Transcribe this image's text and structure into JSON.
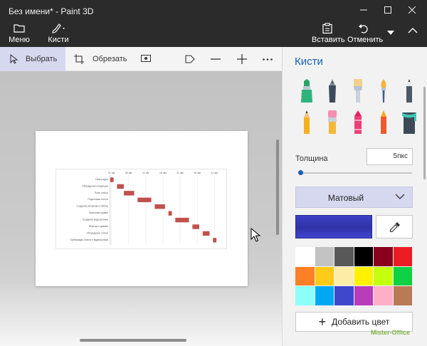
{
  "window": {
    "title": "Без имени* - Paint 3D",
    "minimize_icon": "minimize-icon",
    "maximize_icon": "maximize-icon",
    "close_icon": "close-icon"
  },
  "ribbon": {
    "menu_label": "Меню",
    "brushes_label": "Кисти",
    "paste_label": "Вставить",
    "undo_label": "Отменить",
    "icons": [
      "folder-icon",
      "brush-icon",
      "paste-icon",
      "undo-icon",
      "chevron-down-icon",
      "chevron-up-icon"
    ]
  },
  "toolbar": {
    "select_label": "Выбрать",
    "crop_label": "Обрезать",
    "icons": [
      "cursor-icon",
      "crop-icon",
      "magic-select-icon",
      "sticker-icon",
      "zoom-out-icon",
      "zoom-in-icon",
      "more-icon"
    ]
  },
  "panel": {
    "title": "Кисти",
    "brushes": [
      "marker",
      "calligraphy-pen",
      "oil-brush",
      "watercolor",
      "pencil",
      "eraser",
      "crayon",
      "pixel-pen",
      "spray-can",
      "fill"
    ],
    "thickness_label": "Толщина",
    "thickness_value": "5пкс",
    "thickness_level": 0.02,
    "finish_value": "Матовый",
    "current_color": "#3a3fc3",
    "palette": [
      "#ffffff",
      "#c3c3c3",
      "#585858",
      "#000000",
      "#88001b",
      "#ec1c24",
      "#ff7f27",
      "#ffca18",
      "#fdeca6",
      "#fff200",
      "#c4ff0e",
      "#0ed145",
      "#8cfffb",
      "#00a8f3",
      "#3f48cc",
      "#b83dba",
      "#ffaec8",
      "#b97a56"
    ],
    "add_color_label": "Добавить цвет",
    "watermark": "Mister-Office"
  },
  "chart_data": {
    "type": "gantt",
    "bar_color": "#c0504d",
    "ticks": [
      "01 авг",
      "06 авг",
      "11 авг",
      "16 авг",
      "21 авг",
      "26 авг",
      "31 авг"
    ],
    "tasks": [
      {
        "name": "Поиск идеи",
        "start": 0,
        "duration": 1
      },
      {
        "name": "Обсуждение концепции",
        "start": 2,
        "duration": 2
      },
      {
        "name": "План статьи",
        "start": 4,
        "duration": 3
      },
      {
        "name": "Подготовка текста",
        "start": 8,
        "duration": 4
      },
      {
        "name": "Создание рисунков и таблиц",
        "start": 13,
        "duration": 3
      },
      {
        "name": "Внесение правок",
        "start": 17,
        "duration": 1
      },
      {
        "name": "Создание видеоролика",
        "start": 19,
        "duration": 4
      },
      {
        "name": "Вёрстка и дизайн",
        "start": 24,
        "duration": 2
      },
      {
        "name": "Обсуждение статьи",
        "start": 27,
        "duration": 2
      },
      {
        "name": "Публикация статьи и видеоролика",
        "start": 30,
        "duration": 1
      }
    ]
  }
}
